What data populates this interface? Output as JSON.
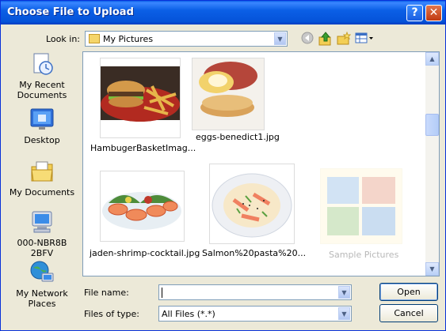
{
  "window": {
    "title": "Choose File to Upload",
    "help_glyph": "?",
    "close_glyph": "✕"
  },
  "lookin": {
    "label": "Look in:",
    "value": "My Pictures"
  },
  "toolbar": {
    "back_icon": "back-icon",
    "up_icon": "up-folder-icon",
    "new_folder_icon": "new-folder-icon",
    "views_icon": "views-menu-icon"
  },
  "places": [
    {
      "label": "My Recent Documents",
      "icon": "recent-documents-icon"
    },
    {
      "label": "Desktop",
      "icon": "desktop-icon"
    },
    {
      "label": "My Documents",
      "icon": "my-documents-icon"
    },
    {
      "label": "000-NBR8B2BFV",
      "icon": "my-computer-icon"
    },
    {
      "label": "My Network Places",
      "icon": "network-places-icon"
    }
  ],
  "files": [
    {
      "caption": "HambugerBasketImag..."
    },
    {
      "caption": "eggs-benedict1.jpg"
    },
    {
      "caption": "jaden-shrimp-cocktail.jpg"
    },
    {
      "caption": "Salmon%20pasta%20..."
    },
    {
      "caption": "Sample Pictures"
    }
  ],
  "filename": {
    "label": "File name:",
    "value": ""
  },
  "filetype": {
    "label": "Files of type:",
    "value": "All Files (*.*)"
  },
  "buttons": {
    "open": "Open",
    "cancel": "Cancel"
  }
}
